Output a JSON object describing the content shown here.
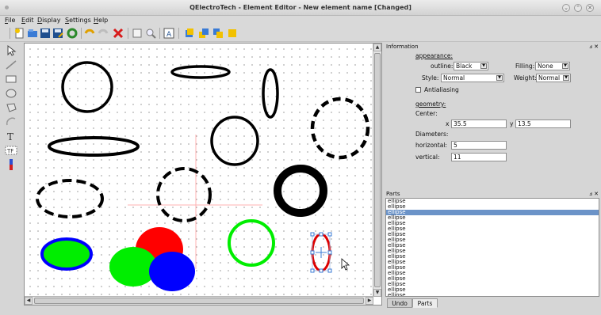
{
  "window": {
    "title": "QElectroTech - Element Editor - New element name [Changed]",
    "controls": [
      "⌄",
      "⌃",
      "✕"
    ]
  },
  "menu": [
    "File",
    "Edit",
    "Display",
    "Settings",
    "Help"
  ],
  "toolbar": {
    "icons": [
      "new-icon",
      "open-icon",
      "save-icon",
      "save-as-icon",
      "reload-icon",
      "undo-icon",
      "redo-icon",
      "delete-icon",
      "select-all-icon",
      "zoom-icon",
      "text-icon",
      "bring-forward-icon",
      "raise-icon",
      "lower-icon",
      "send-backward-icon"
    ]
  },
  "tools": [
    "pointer-icon",
    "line-icon",
    "rectangle-icon",
    "ellipse-icon",
    "polygon-icon",
    "arc-icon",
    "text-tool-icon",
    "text-field-icon",
    "terminal-icon"
  ],
  "information": {
    "title": "Information",
    "appearance_heading": "appearance:",
    "outline_label": "outline:",
    "outline_value": "Black",
    "filling_label": "Filling:",
    "filling_value": "None",
    "style_label": "Style:",
    "style_value": "Normal",
    "weight_label": "Weight:",
    "weight_value": "Normal",
    "antialiasing_label": "Antialiasing",
    "geometry_heading": "geometry:",
    "center_label": "Center:",
    "x_label": "x",
    "x_value": "35.5",
    "y_label": "y",
    "y_value": "13.5",
    "diameters_label": "Diameters:",
    "horizontal_label": "horizontal:",
    "horizontal_value": "5",
    "vertical_label": "vertical:",
    "vertical_value": "11"
  },
  "parts": {
    "title": "Parts",
    "items": [
      "ellipse",
      "ellipse",
      "ellipse",
      "ellipse",
      "ellipse",
      "ellipse",
      "ellipse",
      "ellipse",
      "ellipse",
      "ellipse",
      "ellipse",
      "ellipse",
      "ellipse",
      "ellipse",
      "ellipse",
      "ellipse",
      "ellipse",
      "ellipse"
    ],
    "selected_index": 2
  },
  "tabs": [
    "Undo",
    "Parts"
  ],
  "dock_controls": "ⅎ ✕",
  "colors": {
    "selection": "#6b93c8",
    "shape_red": "#ff0000",
    "shape_green": "#00ff00",
    "shape_blue": "#0000ff"
  }
}
